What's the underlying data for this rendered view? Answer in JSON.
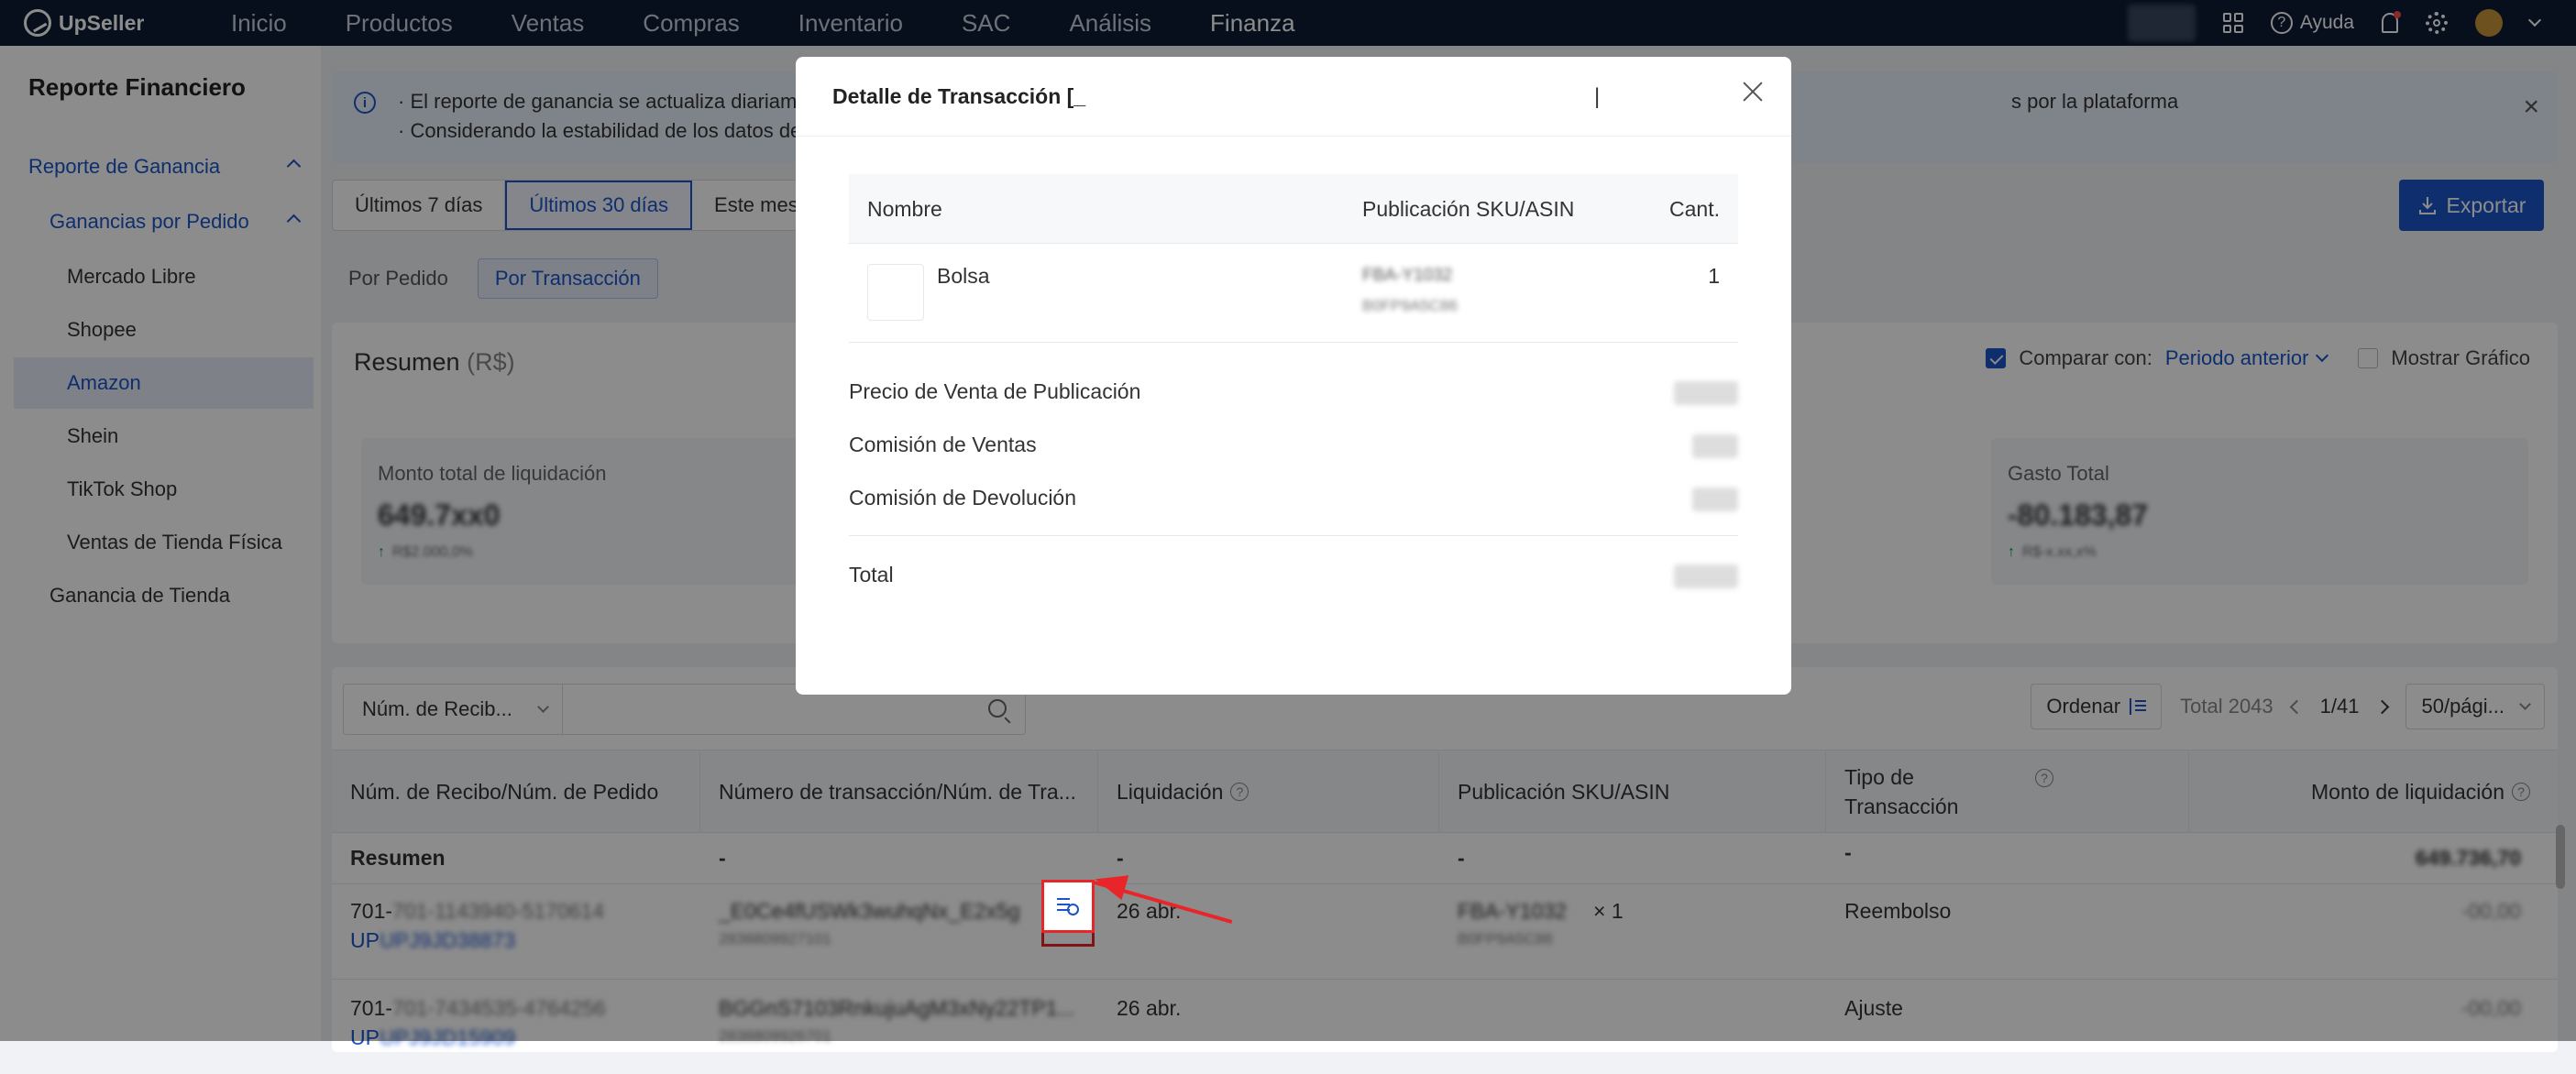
{
  "app": {
    "logo_text": "UpSeller",
    "nav": [
      "Inicio",
      "Productos",
      "Ventas",
      "Compras",
      "Inventario",
      "SAC",
      "Análisis",
      "Finanza"
    ],
    "active_nav": "Finanza",
    "help_label": "Ayuda"
  },
  "sidebar": {
    "title": "Reporte Financiero",
    "items": [
      {
        "label": "Reporte de Ganancia"
      },
      {
        "label": "Ganancias por Pedido"
      },
      {
        "label": "Mercado Libre"
      },
      {
        "label": "Shopee"
      },
      {
        "label": "Amazon"
      },
      {
        "label": "Shein"
      },
      {
        "label": "TikTok Shop"
      },
      {
        "label": "Ventas de Tienda Física"
      },
      {
        "label": "Ganancia de Tienda"
      }
    ]
  },
  "banner": {
    "line1_start": "· El reporte de ganancia se actualiza diariame",
    "line1_end": "s por la plataforma",
    "line2": "· Considerando la estabilidad de los datos de"
  },
  "toolbar": {
    "ranges": [
      "Últimos 7 días",
      "Últimos 30 días",
      "Este mes"
    ],
    "active_range": "Últimos 30 días",
    "export_label": "Exportar"
  },
  "view_tabs": {
    "items": [
      "Por Pedido",
      "Por Transacción"
    ],
    "active": "Por Transacción"
  },
  "summary": {
    "title": "Resumen",
    "currency": "(R$)",
    "compare_label": "Comparar con:",
    "compare_value": "Periodo anterior",
    "compare_checked": true,
    "show_chart_label": "Mostrar Gráfico",
    "show_chart_checked": false,
    "cards": [
      {
        "label": "Monto total de liquidación",
        "value": "649.7xx0",
        "trend": "R$2.000,0%"
      },
      {
        "label": "Gasto Total",
        "value": "-80.183,87",
        "trend": "R$-x.xx,x%"
      }
    ]
  },
  "table": {
    "filter_select": "Núm. de Recib...",
    "search_value": "",
    "sort_label": "Ordenar",
    "total": "Total 2043",
    "page": "1/41",
    "per_page": "50/pági...",
    "columns": [
      "Núm. de Recibo/Núm. de Pedido",
      "Número de transacción/Núm. de Tra...",
      "Liquidación",
      "Publicación SKU/ASIN",
      "Tipo de Transacción",
      "Monto de liquidación"
    ],
    "summary_row": {
      "label": "Resumen",
      "dash": "-",
      "amount": "649.736,70"
    },
    "rows": [
      {
        "receipt": "701-1143940-5170614",
        "order": "UPJ9JD38873",
        "transaction": "_E0Ce4fUSWk3wuhqNx_E2x5g",
        "transaction_sub": "2838809927101",
        "settlement": "26 abr.",
        "sku": "FBA-Y1032",
        "qty": "× 1",
        "asin": "B0FP9A5C86",
        "type": "Reembolso",
        "amount": "-00,00"
      },
      {
        "receipt": "701-7434535-4764256",
        "order": "UPJ9JD15909",
        "transaction": "BGGnS7103RnkujuAgM3xNy22TP1...",
        "transaction_sub": "2838809926701",
        "settlement": "26 abr.",
        "sku": "",
        "qty": "",
        "asin": "",
        "type": "Ajuste",
        "amount": "-00,00"
      }
    ]
  },
  "modal": {
    "title": "Detalle de Transacción [_",
    "caret": "|",
    "columns": [
      "Nombre",
      "Publicación SKU/ASIN",
      "Cant."
    ],
    "item": {
      "name": "Bolsa",
      "sku": "FBA-Y1032",
      "asin": "B0FP9A5C86",
      "qty": "1"
    },
    "lines": [
      {
        "label": "Precio de Venta de Publicación"
      },
      {
        "label": "Comisión de Ventas"
      },
      {
        "label": "Comisión de Devolución"
      }
    ],
    "total_label": "Total"
  },
  "colors": {
    "accent": "#1a54c8",
    "nav_bg": "#0d1a33",
    "highlight_red": "#e8262a"
  }
}
